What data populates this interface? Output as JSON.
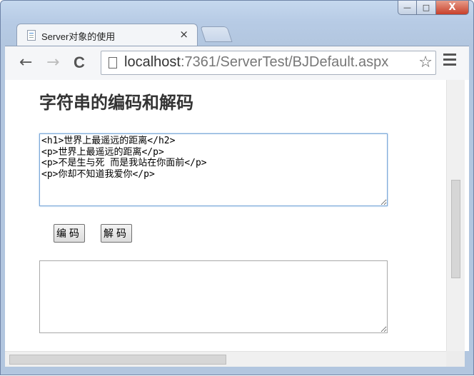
{
  "browser": {
    "tab_title": "Server对象的使用",
    "tab_close": "×",
    "url_host": "localhost",
    "url_rest": ":7361/ServerTest/BJDefault.aspx",
    "back_glyph": "←",
    "forward_glyph": "→",
    "reload_glyph": "C",
    "star_glyph": "☆",
    "window_min": "—",
    "window_max": "□",
    "window_close": "X"
  },
  "page": {
    "heading": "字符串的编码和解码",
    "input_text": "<h1>世界上最遥远的距离</h2>\n<p>世界上最遥远的距离</p>\n<p>不是生与死 而是我站在你面前</p>\n<p>你却不知道我爱你</p>",
    "output_text": "",
    "encode_button": "编码",
    "decode_button": "解码"
  },
  "icons": [
    "page-icon",
    "back-icon",
    "forward-icon",
    "reload-icon",
    "star-icon",
    "menu-icon",
    "close-icon"
  ]
}
